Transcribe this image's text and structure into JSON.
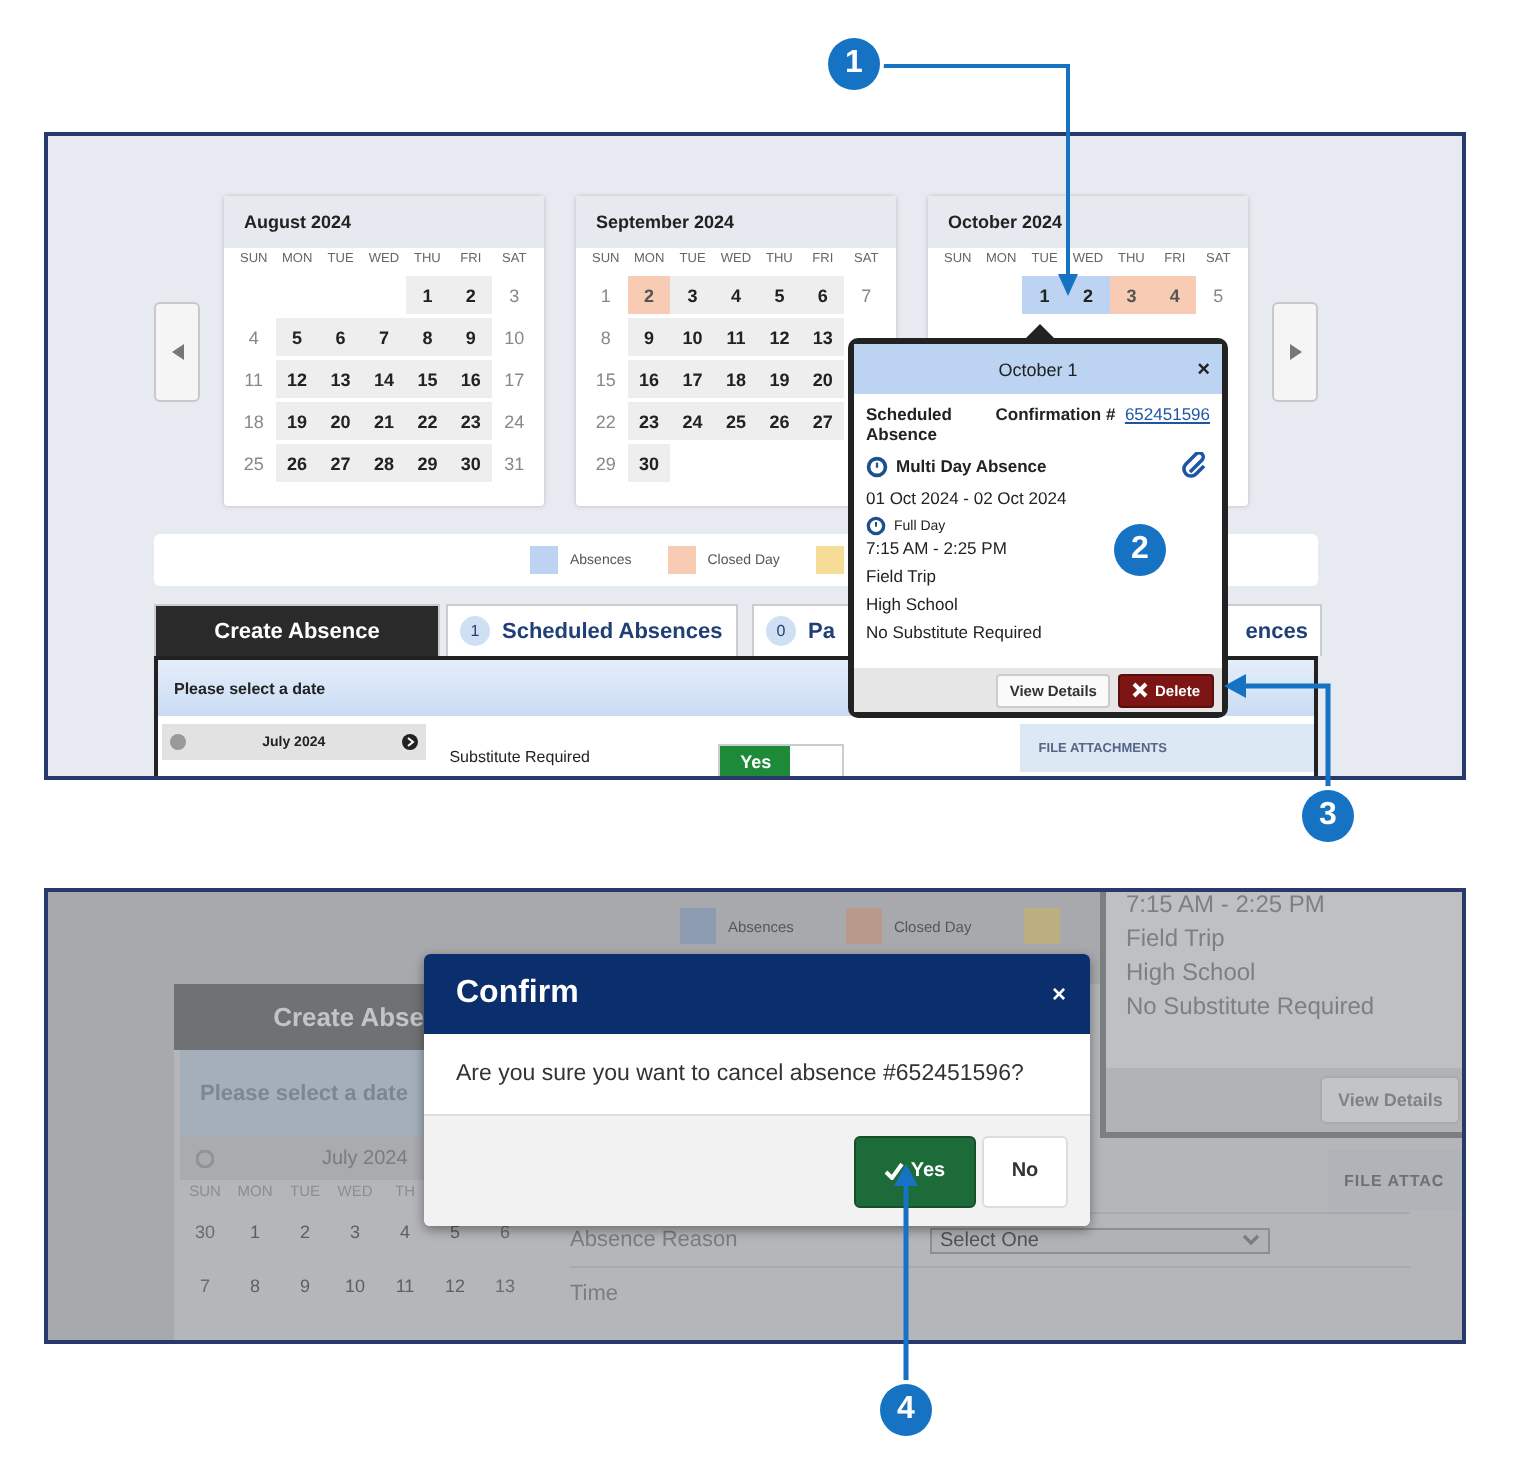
{
  "callouts": [
    {
      "number": "1"
    },
    {
      "number": "2"
    },
    {
      "number": "3"
    },
    {
      "number": "4"
    }
  ],
  "screen_1": {
    "calendars": [
      {
        "title": "August 2024",
        "weekdays": [
          "SUN",
          "MON",
          "TUE",
          "WED",
          "THU",
          "FRI",
          "SAT"
        ],
        "weeks": [
          [
            {
              "kind": "blank"
            },
            {
              "kind": "blank"
            },
            {
              "kind": "blank"
            },
            {
              "kind": "blank"
            },
            {
              "day": "1",
              "kind": "school"
            },
            {
              "day": "2",
              "kind": "school"
            },
            {
              "day": "3",
              "kind": "weekend"
            }
          ],
          [
            {
              "day": "4",
              "kind": "weekend"
            },
            {
              "day": "5",
              "kind": "school"
            },
            {
              "day": "6",
              "kind": "school"
            },
            {
              "day": "7",
              "kind": "school"
            },
            {
              "day": "8",
              "kind": "school"
            },
            {
              "day": "9",
              "kind": "school"
            },
            {
              "day": "10",
              "kind": "weekend"
            }
          ],
          [
            {
              "day": "11",
              "kind": "weekend"
            },
            {
              "day": "12",
              "kind": "school"
            },
            {
              "day": "13",
              "kind": "school"
            },
            {
              "day": "14",
              "kind": "school"
            },
            {
              "day": "15",
              "kind": "school"
            },
            {
              "day": "16",
              "kind": "school"
            },
            {
              "day": "17",
              "kind": "weekend"
            }
          ],
          [
            {
              "day": "18",
              "kind": "weekend"
            },
            {
              "day": "19",
              "kind": "school"
            },
            {
              "day": "20",
              "kind": "school"
            },
            {
              "day": "21",
              "kind": "school"
            },
            {
              "day": "22",
              "kind": "school"
            },
            {
              "day": "23",
              "kind": "school"
            },
            {
              "day": "24",
              "kind": "weekend"
            }
          ],
          [
            {
              "day": "25",
              "kind": "weekend"
            },
            {
              "day": "26",
              "kind": "school"
            },
            {
              "day": "27",
              "kind": "school"
            },
            {
              "day": "28",
              "kind": "school"
            },
            {
              "day": "29",
              "kind": "school"
            },
            {
              "day": "30",
              "kind": "school"
            },
            {
              "day": "31",
              "kind": "weekend"
            }
          ]
        ]
      },
      {
        "title": "September 2024",
        "weekdays": [
          "SUN",
          "MON",
          "TUE",
          "WED",
          "THU",
          "FRI",
          "SAT"
        ],
        "weeks": [
          [
            {
              "day": "1",
              "kind": "weekend"
            },
            {
              "day": "2",
              "kind": "closed"
            },
            {
              "day": "3",
              "kind": "school"
            },
            {
              "day": "4",
              "kind": "school"
            },
            {
              "day": "5",
              "kind": "school"
            },
            {
              "day": "6",
              "kind": "school"
            },
            {
              "day": "7",
              "kind": "weekend"
            }
          ],
          [
            {
              "day": "8",
              "kind": "weekend"
            },
            {
              "day": "9",
              "kind": "school"
            },
            {
              "day": "10",
              "kind": "school"
            },
            {
              "day": "11",
              "kind": "school"
            },
            {
              "day": "12",
              "kind": "school"
            },
            {
              "day": "13",
              "kind": "school"
            }
          ],
          [
            {
              "day": "15",
              "kind": "weekend"
            },
            {
              "day": "16",
              "kind": "school"
            },
            {
              "day": "17",
              "kind": "school"
            },
            {
              "day": "18",
              "kind": "school"
            },
            {
              "day": "19",
              "kind": "school"
            },
            {
              "day": "20",
              "kind": "school"
            }
          ],
          [
            {
              "day": "22",
              "kind": "weekend"
            },
            {
              "day": "23",
              "kind": "school"
            },
            {
              "day": "24",
              "kind": "school"
            },
            {
              "day": "25",
              "kind": "school"
            },
            {
              "day": "26",
              "kind": "school"
            },
            {
              "day": "27",
              "kind": "school"
            }
          ],
          [
            {
              "day": "29",
              "kind": "weekend"
            },
            {
              "day": "30",
              "kind": "school"
            }
          ]
        ]
      },
      {
        "title": "October 2024",
        "weekdays": [
          "SUN",
          "MON",
          "TUE",
          "WED",
          "THU",
          "FRI",
          "SAT"
        ],
        "weeks": [
          [
            {
              "kind": "blank"
            },
            {
              "kind": "blank"
            },
            {
              "day": "1",
              "kind": "absence"
            },
            {
              "day": "2",
              "kind": "absence"
            },
            {
              "day": "3",
              "kind": "closed"
            },
            {
              "day": "4",
              "kind": "closed"
            },
            {
              "day": "5",
              "kind": "weekend"
            }
          ]
        ]
      }
    ],
    "legend": [
      {
        "label": "Absences",
        "color": "#bcd3f2"
      },
      {
        "label": "Closed Day",
        "color": "#f8cbb5"
      },
      {
        "color": "#f6dc94"
      }
    ],
    "tabs": [
      {
        "label": "Create Absence",
        "selected": true
      },
      {
        "count": "1",
        "label": "Scheduled Absences",
        "selected": false
      },
      {
        "count": "0",
        "label": "Pa",
        "label_end": "ences",
        "selected": false
      }
    ],
    "prompt": "Please select a date",
    "mini_calendar": {
      "title": "July 2024"
    },
    "substitute": {
      "label": "Substitute Required",
      "on_label": "Yes",
      "on": true
    },
    "attachments_heading": "FILE ATTACHMENTS",
    "popup": {
      "title": "October 1",
      "close": "×",
      "status": "Scheduled Absence",
      "confirmation_label": "Confirmation #",
      "confirmation": "652451596",
      "type": "Multi Day Absence",
      "dates": "01 Oct 2024 - 02 Oct 2024",
      "duration": "Full Day",
      "time": "7:15 AM - 2:25 PM",
      "reason": "Field Trip",
      "location": "High School",
      "substitute": "No Substitute Required",
      "buttons": [
        {
          "label": "View Details",
          "kind": "default"
        },
        {
          "label": "Delete",
          "kind": "danger"
        }
      ]
    }
  },
  "screen_2": {
    "legend": [
      {
        "label": "Absences",
        "color": "#8d9bb0"
      },
      {
        "label": "Closed Day",
        "color": "#b8998c"
      },
      {
        "color": "#bcae7e"
      }
    ],
    "tab": "Create Abse",
    "prompt": "Please select a date",
    "mini_calendar": {
      "title": "July 2024",
      "weekdays": [
        "SUN",
        "MON",
        "TUE",
        "WED",
        "TH"
      ],
      "weeks": [
        [
          {
            "day": "30",
            "kind": "other"
          },
          {
            "day": "1",
            "kind": "school"
          },
          {
            "day": "2",
            "kind": "school"
          },
          {
            "day": "3",
            "kind": "school"
          },
          {
            "day": "4",
            "kind": "school"
          },
          {
            "day": "5",
            "kind": "school"
          },
          {
            "day": "6",
            "kind": "weekend"
          }
        ],
        [
          {
            "day": "7",
            "kind": "weekend"
          },
          {
            "day": "8",
            "kind": "school"
          },
          {
            "day": "9",
            "kind": "school"
          },
          {
            "day": "10",
            "kind": "school"
          },
          {
            "day": "11",
            "kind": "school"
          },
          {
            "day": "12",
            "kind": "school"
          },
          {
            "day": "13",
            "kind": "weekend"
          }
        ]
      ]
    },
    "reason": {
      "label": "Absence Reason",
      "placeholder": "Select One"
    },
    "time_label": "Time",
    "attachments_heading": "FILE ATTAC",
    "popup": {
      "time": "7:15 AM - 2:25 PM",
      "reason": "Field Trip",
      "location": "High School",
      "substitute": "No Substitute Required",
      "button": "View Details"
    },
    "dialog": {
      "title": "Confirm",
      "close": "×",
      "message": "Are you sure you want to cancel absence #652451596?",
      "buttons": [
        {
          "label": "Yes",
          "kind": "primary"
        },
        {
          "label": "No",
          "kind": "default"
        }
      ]
    }
  }
}
